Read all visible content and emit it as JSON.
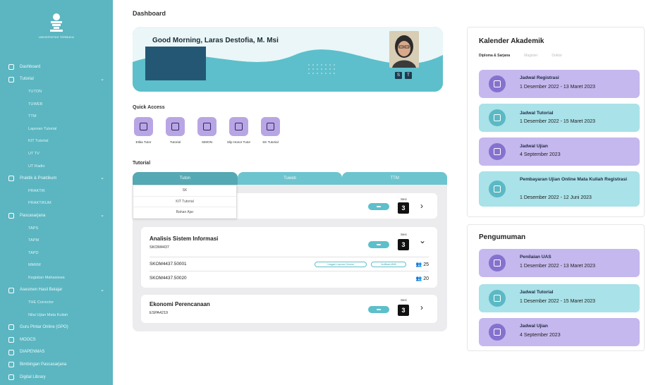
{
  "sidebar": {
    "logo_text": "UNIVERSITAS TERBUKA",
    "items": [
      {
        "label": "Dashboard",
        "icon": "home-icon"
      },
      {
        "label": "Tutorial",
        "icon": "people-icon",
        "expandable": true
      },
      {
        "label": "TUTON",
        "sub": true
      },
      {
        "label": "TUWEB",
        "sub": true
      },
      {
        "label": "TTM",
        "sub": true
      },
      {
        "label": "Laporan Tutorial",
        "sub": true
      },
      {
        "label": "KIT Tutorial",
        "sub": true
      },
      {
        "label": "UT TV",
        "sub": true
      },
      {
        "label": "UT Radio",
        "sub": true
      },
      {
        "label": "Praktik & Praktikum",
        "icon": "flask-icon",
        "expandable": true
      },
      {
        "label": "PRAKTIK",
        "sub": true
      },
      {
        "label": "PRAKTIKUM",
        "sub": true
      },
      {
        "label": "Pascasarjana",
        "icon": "graduate-icon",
        "expandable": true
      },
      {
        "label": "TAPS",
        "sub": true
      },
      {
        "label": "TAPM",
        "sub": true
      },
      {
        "label": "TAPD",
        "sub": true
      },
      {
        "label": "MMKM",
        "sub": true
      },
      {
        "label": "Kegiatan Mahasiswa",
        "sub": true
      },
      {
        "label": "Asesmen Hasil Belajar",
        "icon": "assessment-icon",
        "expandable": true
      },
      {
        "label": "THE Corrector",
        "sub": true
      },
      {
        "label": "Nilai Ujian Mata Kuliah",
        "sub": true
      },
      {
        "label": "Guru Pintar Online (GPO)",
        "icon": "monitor-icon"
      },
      {
        "label": "MOOCS",
        "icon": "book-icon"
      },
      {
        "label": "DIAPENMAS",
        "icon": "document-icon"
      },
      {
        "label": "Bimbingan Pascasarjana",
        "icon": "chat-icon"
      },
      {
        "label": "Digital Library",
        "icon": "library-icon"
      }
    ]
  },
  "page_title": "Dashboard",
  "hero": {
    "greeting": "Good Morning, Laras Destofia, M. Msi",
    "icon_a": "S",
    "icon_b": "T"
  },
  "quick_access": {
    "title": "Quick Access",
    "items": [
      {
        "label": "Etika Tutor",
        "icon": "id-card-icon"
      },
      {
        "label": "Tutorial",
        "icon": "monitor-icon"
      },
      {
        "label": "SIMON",
        "icon": "chart-board-icon"
      },
      {
        "label": "Slip Honor Tutor",
        "icon": "receipt-icon"
      },
      {
        "label": "SK Tutorial",
        "icon": "file-icon"
      }
    ]
  },
  "tutorial": {
    "title": "Tutorial",
    "tabs": [
      "Tuton",
      "Tuweb",
      "TTM"
    ],
    "dropdown": [
      "SK",
      "KIT Tutorial",
      "Bahan Ajar"
    ],
    "sesi_label": "Sesi",
    "courses": [
      {
        "name": "",
        "code": "",
        "sesi": "3",
        "expanded": false
      },
      {
        "name": "Analisis Sistem Informasi",
        "code": "SKOM4437",
        "sesi": "3",
        "expanded": true,
        "classes": [
          {
            "code": "SKOM4437.50001",
            "count": "25",
            "btn1": "Unggah Laporan Tutorial",
            "btn2": "Verifikasi MMK"
          },
          {
            "code": "SKOM4437.50020",
            "count": "20"
          }
        ]
      },
      {
        "name": "Ekonomi Perencanaan",
        "code": "ESPA4219",
        "sesi": "3",
        "expanded": false
      }
    ]
  },
  "calendar": {
    "title": "Kalender Akademik",
    "tabs": [
      "Diploma & Sarjana",
      "Magister",
      "Doktor"
    ],
    "events": [
      {
        "title": "Jadwal Registrasi",
        "date": "1 Desember 2022 - 13 Maret 2023",
        "color": "purple"
      },
      {
        "title": "Jadwal Tutorial",
        "date": "1 Desember 2022 - 15 Maret 2023",
        "color": "teal"
      },
      {
        "title": "Jadwal Ujian",
        "date": "4 September 2023",
        "color": "purple"
      },
      {
        "title": "Pembayaran Ujian Online Mata Kuliah Registrasi",
        "date": "1 Desember 2022 - 12 Juni 2023",
        "color": "teal"
      }
    ]
  },
  "announcements": {
    "title": "Pengumuman",
    "items": [
      {
        "title": "Penilaian UAS",
        "date": "1 Desember 2022 - 13 Maret 2023",
        "color": "purple"
      },
      {
        "title": "Jadwal Tutorial",
        "date": "1 Desember 2022 - 15 Maret 2023",
        "color": "teal"
      },
      {
        "title": "Jadwal Ujian",
        "date": "4 September 2023",
        "color": "purple"
      }
    ]
  },
  "colors": {
    "sidebar": "#5bb6c1",
    "accent": "#5dbfcb",
    "purple": "#c5b8ee",
    "teal": "#a9e2e8"
  }
}
